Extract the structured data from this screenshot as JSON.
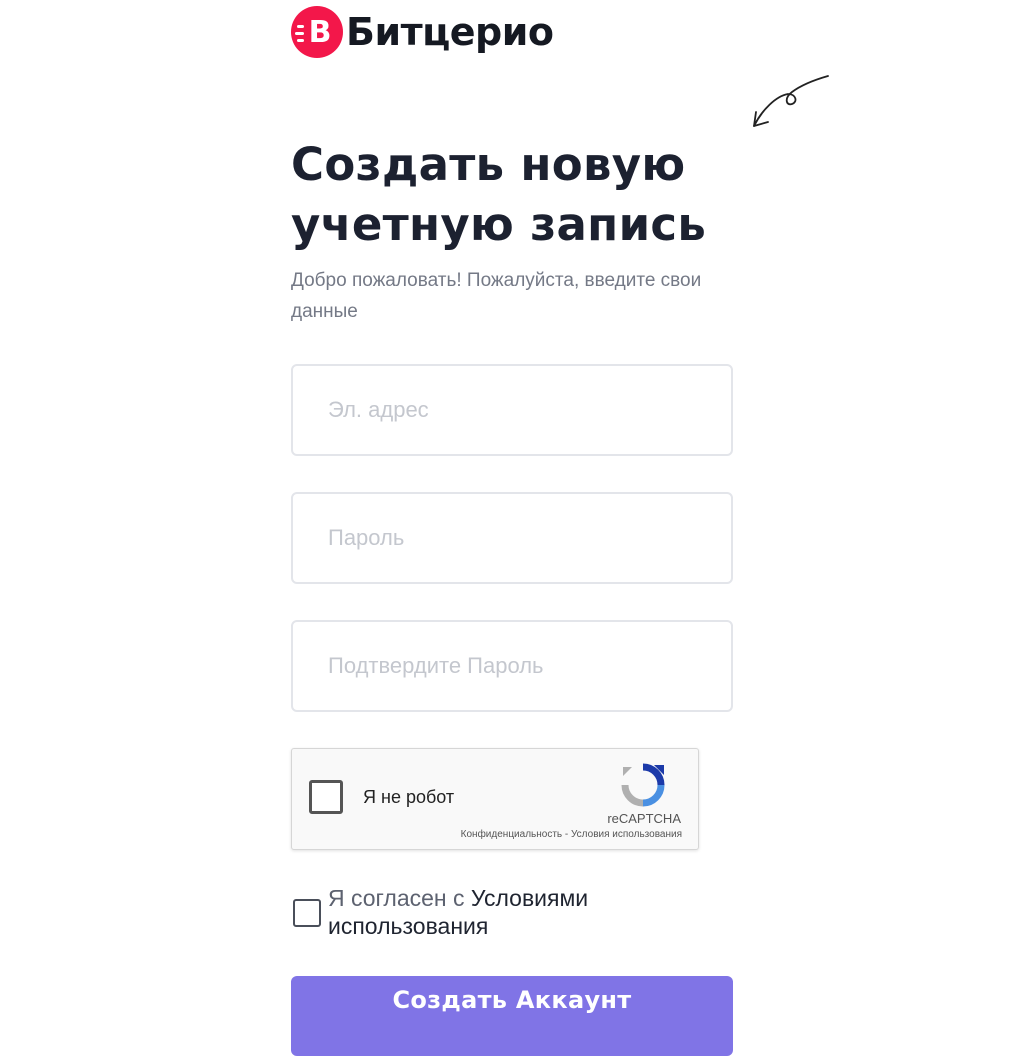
{
  "brand": {
    "name": "Битцерио",
    "badge_letter": "B",
    "badge_color": "#f3174a"
  },
  "header": {
    "title": "Создать новую учетную запись",
    "subtitle": "Добро пожаловать! Пожалуйста, введите свои данные"
  },
  "form": {
    "email": {
      "placeholder": "Эл. адрес",
      "value": ""
    },
    "password": {
      "placeholder": "Пароль",
      "value": ""
    },
    "confirm_password": {
      "placeholder": "Подтвердите Пароль",
      "value": ""
    },
    "captcha": {
      "label": "Я не робот",
      "brand": "reCAPTCHA",
      "privacy_link": "Конфиденциальность",
      "separator": " - ",
      "terms_link": "Условия использования",
      "checked": false
    },
    "agree": {
      "prefix": "Я согласен с ",
      "link": "Условиями использования",
      "checked": false
    },
    "submit_label": "Создать Аккаунт"
  },
  "colors": {
    "accent": "#8074e6",
    "title": "#1c2130",
    "muted": "#747986",
    "placeholder": "#c4c7ce",
    "border": "#e3e5ea"
  },
  "icons": [
    "brand-logo-icon",
    "decorative-arrow-icon",
    "recaptcha-logo-icon"
  ]
}
